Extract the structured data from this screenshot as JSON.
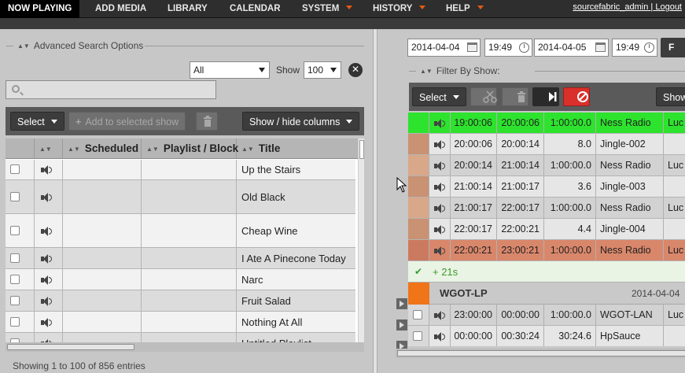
{
  "nav": {
    "items": [
      {
        "label": "NOW PLAYING",
        "active": true,
        "dropdown": false
      },
      {
        "label": "ADD MEDIA",
        "active": false,
        "dropdown": false
      },
      {
        "label": "LIBRARY",
        "active": false,
        "dropdown": false
      },
      {
        "label": "CALENDAR",
        "active": false,
        "dropdown": false
      },
      {
        "label": "SYSTEM",
        "active": false,
        "dropdown": true
      },
      {
        "label": "HISTORY",
        "active": false,
        "dropdown": true
      },
      {
        "label": "HELP",
        "active": false,
        "dropdown": true
      }
    ],
    "user": "sourcefabric_admin",
    "separator": "|",
    "logout": "Logout",
    "accent_color": "#e35a14"
  },
  "library": {
    "advanced_search_label": "Advanced Search Options",
    "type_filter": "All",
    "show_label": "Show",
    "page_size": "100",
    "search_value": "",
    "toolbar": {
      "select_label": "Select",
      "add_label": "Add to selected show",
      "show_hide_label": "Show / hide columns"
    },
    "columns": [
      "Scheduled",
      "Playlist / Block",
      "Title"
    ],
    "rows": [
      {
        "title": "Up the Stairs"
      },
      {
        "title": "Old Black"
      },
      {
        "title": "Cheap Wine"
      },
      {
        "title": "I Ate A Pinecone Today"
      },
      {
        "title": "Narc"
      },
      {
        "title": "Fruit Salad"
      },
      {
        "title": "Nothing At All"
      },
      {
        "title": "Untitled Playlist"
      }
    ],
    "footer": "Showing 1 to 100 of 856 entries"
  },
  "schedule": {
    "start_date": "2014-04-04",
    "start_time": "19:49",
    "end_date": "2014-04-05",
    "end_time": "19:49",
    "find_label": "F",
    "filter_label": "Filter By Show:",
    "toolbar": {
      "select_label": "Select",
      "show_label": "Show"
    },
    "rows": [
      {
        "start": "19:00:06",
        "end": "20:00:06",
        "length": "1:00:00.0",
        "title": "Ness Radio",
        "creator": "Luc",
        "state": "playing"
      },
      {
        "start": "20:00:06",
        "end": "20:00:14",
        "length": "8.0",
        "title": "Jingle-002",
        "creator": "",
        "state": "scheduled"
      },
      {
        "start": "20:00:14",
        "end": "21:00:14",
        "length": "1:00:00.0",
        "title": "Ness Radio",
        "creator": "Luc",
        "state": "scheduled"
      },
      {
        "start": "21:00:14",
        "end": "21:00:17",
        "length": "3.6",
        "title": "Jingle-003",
        "creator": "",
        "state": "scheduled"
      },
      {
        "start": "21:00:17",
        "end": "22:00:17",
        "length": "1:00:00.0",
        "title": "Ness Radio",
        "creator": "Luc",
        "state": "scheduled"
      },
      {
        "start": "22:00:17",
        "end": "22:00:21",
        "length": "4.4",
        "title": "Jingle-004",
        "creator": "",
        "state": "scheduled"
      },
      {
        "start": "22:00:21",
        "end": "23:00:21",
        "length": "1:00:00.0",
        "title": "Ness Radio",
        "creator": "Luc",
        "state": "overbooked"
      }
    ],
    "gap": "+ 21s",
    "show": {
      "name": "WGOT-LP",
      "date": "2014-04-04"
    },
    "show_rows": [
      {
        "start": "23:00:00",
        "end": "00:00:00",
        "length": "1:00:00.0",
        "title": "WGOT-LAN",
        "creator": "Luc"
      },
      {
        "start": "00:00:00",
        "end": "00:30:24",
        "length": "30:24.6",
        "title": "HpSauce",
        "creator": ""
      }
    ],
    "colors": {
      "playing": "#2de32d",
      "scheduled": "#d9a889",
      "overbooked": "#d9876b",
      "show_accent": "#f07418",
      "gap_check": "#2e9e2e"
    }
  }
}
